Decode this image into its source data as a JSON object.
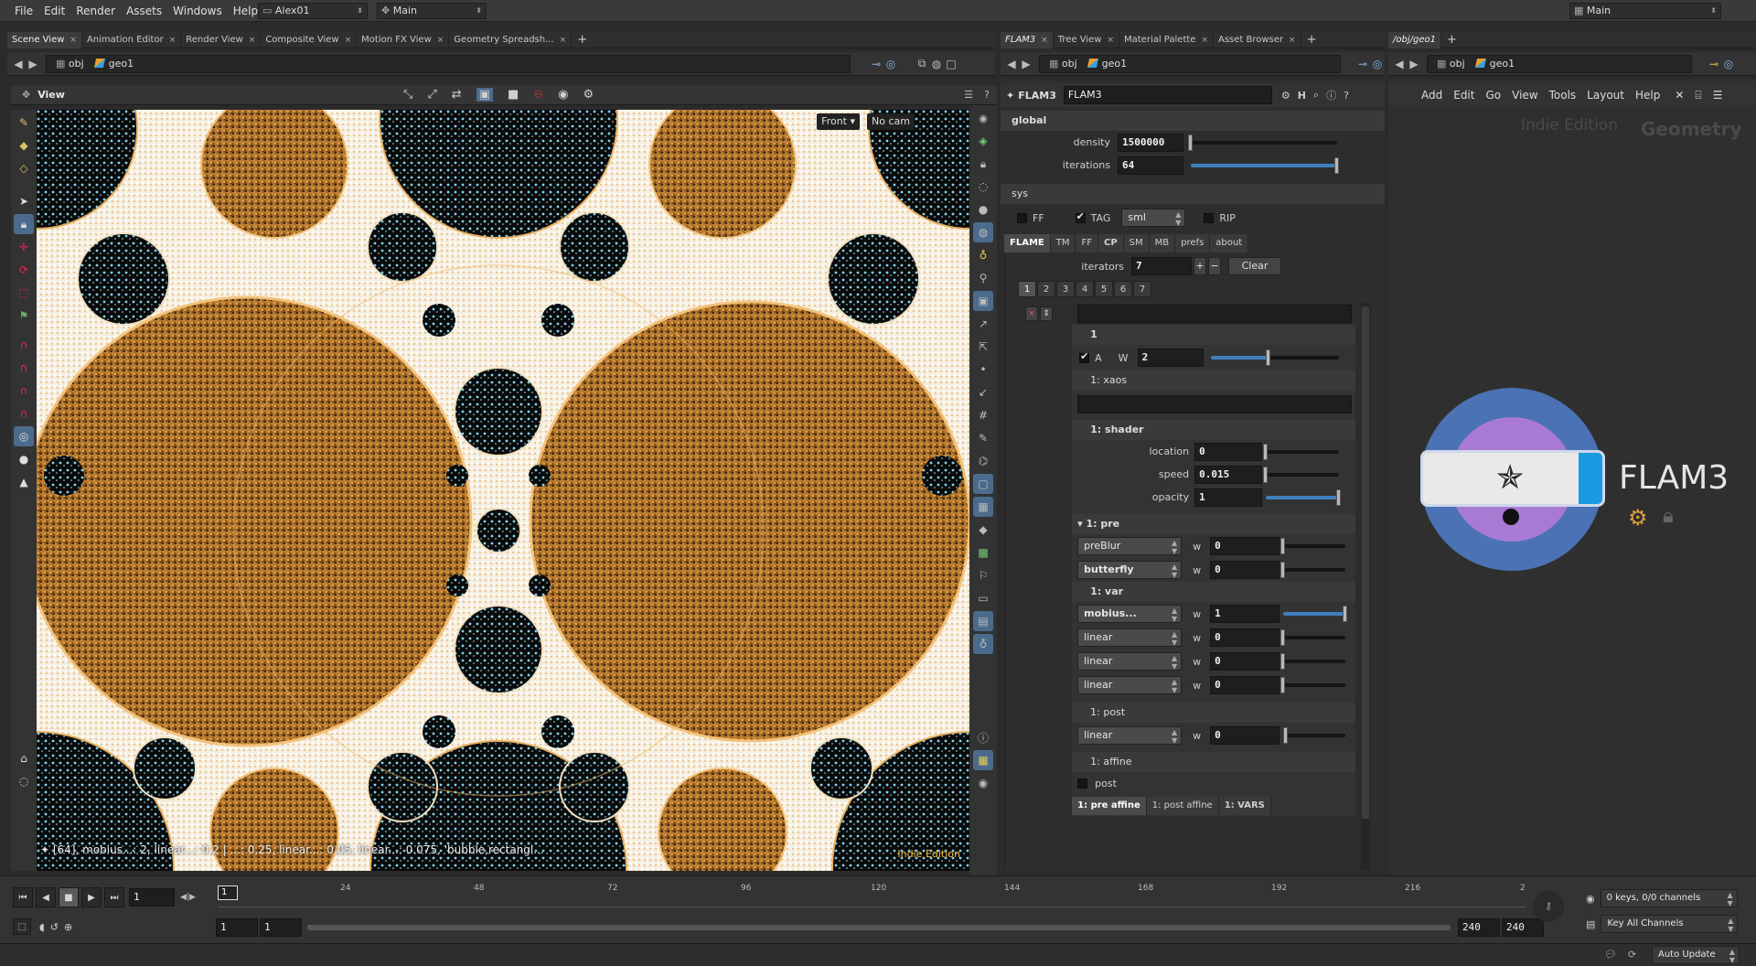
{
  "menubar": {
    "items": [
      "File",
      "Edit",
      "Render",
      "Assets",
      "Windows",
      "Help"
    ],
    "desktop": "Alex01",
    "context": "Main",
    "right_desktop": "Main"
  },
  "left_tabs": [
    "Scene View",
    "Animation Editor",
    "Render View",
    "Composite View",
    "Motion FX View",
    "Geometry Spreadsh..."
  ],
  "mid_tabs": [
    "FLAM3",
    "Tree View",
    "Material Palette",
    "Asset Browser"
  ],
  "right_tabs": [
    "/obj/geo1"
  ],
  "path": {
    "root": "obj",
    "node": "geo1"
  },
  "viewport": {
    "title": "View",
    "camera_menu": "Front",
    "cam_menu": "No cam",
    "status_text": "[64], mobius...: 2, linear...: 0.2 | ...: 0.25, linear...: 0.05, linear...: 0.075, 'bubble,rectangl...",
    "edition": "Indie Edition"
  },
  "params": {
    "node_type": "FLAM3",
    "node_name": "FLAM3",
    "global_label": "global",
    "density_label": "density",
    "density": "1500000",
    "density_frac": 0.0,
    "iterations_label": "iterations",
    "iterations": "64",
    "iterations_frac": 1.0,
    "sys_label": "sys",
    "ff_label": "FF",
    "tag_label": "TAG",
    "format": "sml",
    "rip_label": "RIP",
    "tabs": [
      "FLAME",
      "TM",
      "FF",
      "CP",
      "SM",
      "MB",
      "prefs",
      "about"
    ],
    "iterators_label": "iterators",
    "iterators": "7",
    "plus": "+",
    "minus": "−",
    "clear_label": "Clear",
    "iter_tabs": [
      "1",
      "2",
      "3",
      "4",
      "5",
      "6",
      "7"
    ],
    "iter_header": "1",
    "active_label": "A",
    "weight_label": "W",
    "weight": "2",
    "weight_frac": 0.45,
    "xaos_label": "1: xaos",
    "shader_label": "1: shader",
    "location_label": "location",
    "location": "0",
    "location_frac": 0.0,
    "speed_label": "speed",
    "speed": "0.015",
    "speed_frac": 0.0,
    "opacity_label": "opacity",
    "opacity": "1",
    "opacity_frac": 1.0,
    "pre_label": "1: pre",
    "pre_vars": [
      {
        "name": "preBlur",
        "w": "0",
        "bold": false
      },
      {
        "name": "butterfly",
        "w": "0",
        "bold": true
      }
    ],
    "var_label": "1: var",
    "vars": [
      {
        "name": "mobius...",
        "w": "1",
        "bold": true,
        "frac": 1.0
      },
      {
        "name": "linear",
        "w": "0",
        "bold": false,
        "frac": 0.0
      },
      {
        "name": "linear",
        "w": "0",
        "bold": false,
        "frac": 0.0
      },
      {
        "name": "linear",
        "w": "0",
        "bold": false,
        "frac": 0.0
      }
    ],
    "w_label": "w",
    "post_label": "1: post",
    "post_var": {
      "name": "linear",
      "w": "0"
    },
    "affine_label": "1: affine",
    "post_check_label": "post",
    "bottom_tabs": [
      "1: pre affine",
      "1: post affine",
      "1: VARS"
    ]
  },
  "network": {
    "menu": [
      "Add",
      "Edit",
      "Go",
      "View",
      "Tools",
      "Layout",
      "Help"
    ],
    "edition": "Indie Edition",
    "context": "Geometry",
    "node_label": "FLAM3"
  },
  "timeline": {
    "frame": "1",
    "current": "1",
    "ticks": [
      "24",
      "48",
      "72",
      "96",
      "120",
      "144",
      "168",
      "192",
      "216",
      "2"
    ],
    "range_start": "1",
    "range_start2": "1",
    "range_end": "240",
    "range_end2": "240",
    "keys_info": "0 keys, 0/0 channels",
    "key_all": "Key All Channels"
  },
  "status": {
    "auto_update": "Auto Update"
  }
}
